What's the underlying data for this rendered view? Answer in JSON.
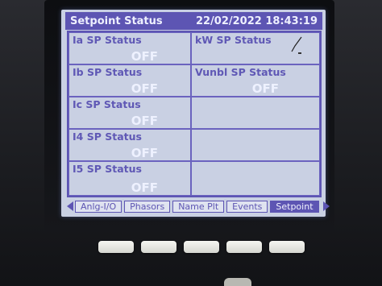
{
  "header": {
    "title": "Setpoint Status",
    "datetime": "22/02/2022 18:43:19"
  },
  "left_cells": [
    {
      "label": "Ia SP Status",
      "value": "OFF"
    },
    {
      "label": "Ib SP Status",
      "value": "OFF"
    },
    {
      "label": "Ic SP Status",
      "value": "OFF"
    },
    {
      "label": "I4 SP Status",
      "value": "OFF"
    },
    {
      "label": "I5 SP Status",
      "value": "OFF"
    }
  ],
  "right_cells": [
    {
      "label": "kW SP Status",
      "value": ""
    },
    {
      "label": "Vunbl SP Status",
      "value": "OFF"
    },
    {
      "label": "",
      "value": ""
    },
    {
      "label": "",
      "value": ""
    },
    {
      "label": "",
      "value": ""
    }
  ],
  "tabs": [
    {
      "label": "Anlg-I/O",
      "active": false
    },
    {
      "label": "Phasors",
      "active": false
    },
    {
      "label": "Name Plt",
      "active": false
    },
    {
      "label": "Events",
      "active": false
    },
    {
      "label": "Setpoint",
      "active": true
    }
  ],
  "colors": {
    "accent": "#5d55b3",
    "screen_bg": "#c9d0e3",
    "value_text": "#eef1ff"
  },
  "icons": [
    "left-arrow-icon",
    "right-arrow-icon",
    "pen-mark-icon"
  ]
}
